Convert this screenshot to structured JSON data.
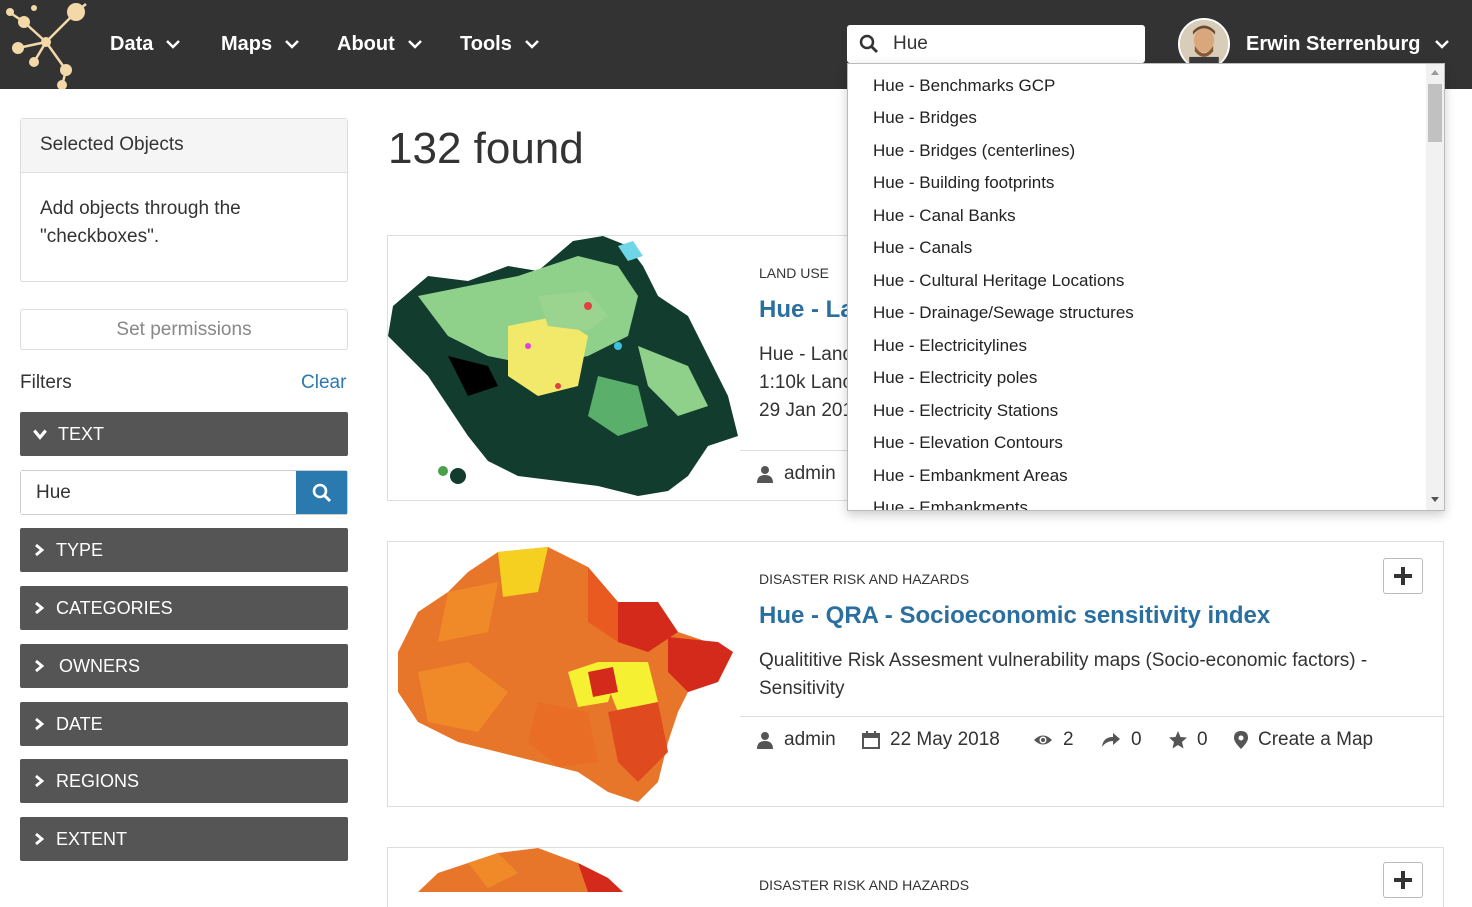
{
  "nav": {
    "items": [
      {
        "label": "Data"
      },
      {
        "label": "Maps"
      },
      {
        "label": "About"
      },
      {
        "label": "Tools"
      }
    ],
    "search_value": "Hue",
    "user_name": "Erwin Sterrenburg"
  },
  "dropdown": {
    "items": [
      "Hue - Benchmarks GCP",
      "Hue - Bridges",
      "Hue - Bridges (centerlines)",
      "Hue - Building footprints",
      "Hue - Canal Banks",
      "Hue - Canals",
      "Hue - Cultural Heritage Locations",
      "Hue - Drainage/Sewage structures",
      "Hue - Electricitylines",
      "Hue - Electricity poles",
      "Hue - Electricity Stations",
      "Hue - Elevation Contours",
      "Hue - Embankment Areas",
      "Hue - Embankments"
    ]
  },
  "sidebar": {
    "selected_title": "Selected Objects",
    "selected_body": "Add objects through the \"checkboxes\".",
    "set_permissions": "Set permissions",
    "filters_label": "Filters",
    "clear_label": "Clear",
    "text_filter_label": "TEXT",
    "text_filter_value": "Hue",
    "filters": [
      "TYPE",
      "CATEGORIES",
      "OWNERS",
      "DATE",
      "REGIONS",
      "EXTENT"
    ]
  },
  "main": {
    "found_text": "132 found",
    "cards": [
      {
        "category": "LAND USE",
        "title": "Hue - La",
        "desc_lines": [
          "Hue - Land",
          "1:10k Lanc",
          "29 Jan 201"
        ],
        "owner": "admin"
      },
      {
        "category": "DISASTER RISK AND HAZARDS",
        "title": "Hue - QRA - Socioeconomic sensitivity index",
        "desc": "Qualititive Risk Assesment vulnerability maps (Socio-economic factors) - Sensitivity",
        "owner": "admin",
        "date": "22 May 2018",
        "views": "2",
        "shares": "0",
        "rating": "0",
        "action": "Create a Map"
      },
      {
        "category": "DISASTER RISK AND HAZARDS"
      }
    ]
  },
  "colors": {
    "navbar": "#333333",
    "filter_bar": "#555555",
    "link": "#2a7ab0",
    "title": "#2a6fa0"
  }
}
